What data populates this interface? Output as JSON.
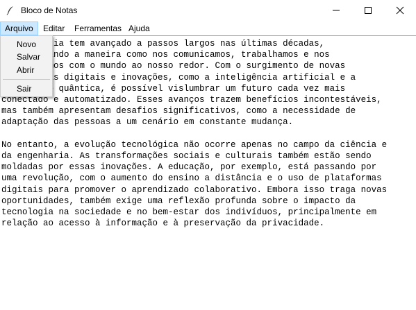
{
  "window": {
    "title": "Bloco de Notas",
    "icon": "feather-icon",
    "controls": [
      "minimize-icon",
      "maximize-icon",
      "close-icon"
    ]
  },
  "menubar": {
    "items": [
      {
        "label": "Arquivo",
        "active": true
      },
      {
        "label": "Editar",
        "active": false
      },
      {
        "label": "Ferramentas",
        "active": false
      },
      {
        "label": "Ajuda",
        "active": false
      }
    ]
  },
  "file_menu": {
    "items": [
      {
        "label": "Novo"
      },
      {
        "label": "Salvar"
      },
      {
        "label": "Abrir"
      },
      {
        "separator": true
      },
      {
        "label": "Sair"
      }
    ]
  },
  "editor": {
    "paragraphs": [
      [
        "A tecnologia tem avançado a passos largos nas últimas décadas,",
        "transformando a maneira como nos comunicamos, trabalhamos e nos",
        "relacionamos com o mundo ao nosso redor. Com o surgimento de novas",
        "ferramentas digitais e inovações, como a inteligência artificial e a",
        "computação quântica, é possível vislumbrar um futuro cada vez mais",
        "conectado e automatizado. Esses avanços trazem benefícios incontestáveis,",
        "mas também apresentam desafios significativos, como a necessidade de",
        "adaptação das pessoas a um cenário em constante mudança."
      ],
      [
        "No entanto, a evolução tecnológica não ocorre apenas no campo da ciência e",
        "da engenharia. As transformações sociais e culturais também estão sendo",
        "moldadas por essas inovações. A educação, por exemplo, está passando por",
        "uma revolução, com o aumento do ensino a distância e o uso de plataformas",
        "digitais para promover o aprendizado colaborativo. Embora isso traga novas",
        "oportunidades, também exige uma reflexão profunda sobre o impacto da",
        "tecnologia na sociedade e no bem-estar dos indivíduos, principalmente em",
        "relação ao acesso à informação e à preservação da privacidade."
      ]
    ]
  },
  "colors": {
    "menu_active_bg": "#cce8ff",
    "menu_active_border": "#99d1ff",
    "dropdown_bg": "#f2f2f2",
    "text": "#000000"
  }
}
